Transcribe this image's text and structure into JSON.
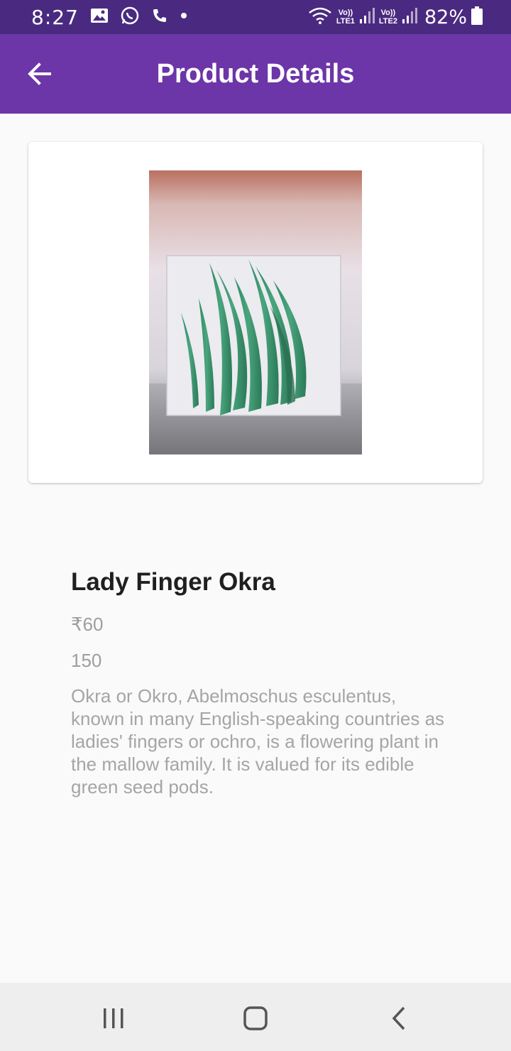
{
  "status_bar": {
    "time": "8:27",
    "lte1": "LTE1",
    "lte2": "LTE2",
    "volte1": "Vo))",
    "volte2": "Vo))",
    "battery": "82%",
    "icons": [
      "gallery-icon",
      "whatsapp-icon",
      "phone-icon",
      "dot-icon",
      "wifi-icon",
      "signal-icon",
      "battery-icon"
    ]
  },
  "app_bar": {
    "title": "Product Details",
    "background": "#6c35a8"
  },
  "product": {
    "name": "Lady Finger Okra",
    "price": "₹60",
    "quantity": "150",
    "description": "Okra or Okro, Abelmoschus esculentus, known in many English-speaking countries as ladies' fingers or ochro, is a flowering plant in the mallow family. It is valued for its edible green seed pods."
  },
  "nav_bar": {
    "buttons": [
      "recents-icon",
      "home-icon",
      "back-icon"
    ]
  }
}
